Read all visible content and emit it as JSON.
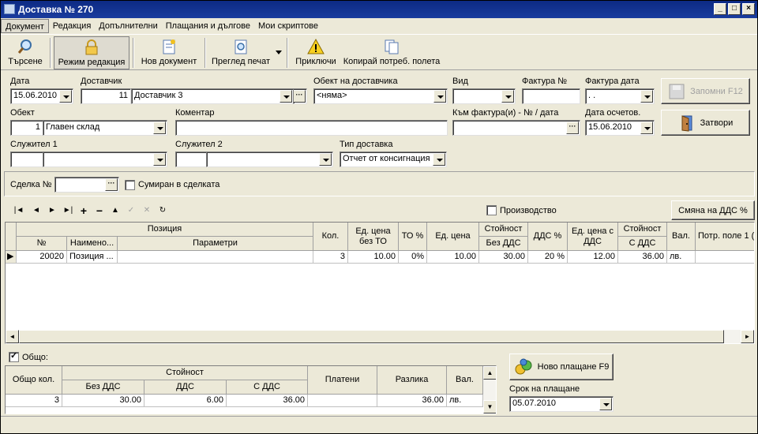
{
  "window": {
    "title": "Доставка № 270"
  },
  "menu": [
    "Документ",
    "Редакция",
    "Допълнителни",
    "Плащания и дългове",
    "Мои скриптове"
  ],
  "toolbar": {
    "search": "Търсене",
    "edit_mode": "Режим редакция",
    "new_doc": "Нов документ",
    "print_preview": "Преглед печат",
    "finish": "Приключи",
    "copy_fields": "Копирай потреб. полета"
  },
  "header": {
    "date_label": "Дата",
    "date_value": "15.06.2010",
    "supplier_label": "Доставчик",
    "supplier_id": "11",
    "supplier_name": "Доставчик 3",
    "supplier_object_label": "Обект на доставчика",
    "supplier_object_value": "<няма>",
    "type_label": "Вид",
    "type_value": "",
    "invoice_label": "Фактура №",
    "invoice_value": "",
    "invoice_date_label": "Фактура дата",
    "invoice_date_value": ". .",
    "object_label": "Обект",
    "object_id": "1",
    "object_name": "Главен склад",
    "comment_label": "Коментар",
    "comment_value": "",
    "to_invoice_label": "Към фактура(и) - № / дата",
    "to_invoice_value": "",
    "accounting_date_label": "Дата осчетов.",
    "accounting_date_value": "15.06.2010",
    "employee1_label": "Служител 1",
    "employee2_label": "Служител 2",
    "delivery_type_label": "Тип доставка",
    "delivery_type_value": "Отчет от консигнация"
  },
  "buttons": {
    "save": "Запомни  F12",
    "close": "Затвори",
    "vat_change": "Смяна на ДДС %",
    "new_payment": "Ново плащане  F9"
  },
  "deal": {
    "label": "Сделка №",
    "value": "",
    "summed_label": "Сумиран в сделката",
    "summed": false
  },
  "production": {
    "label": "Производство",
    "checked": false
  },
  "items_grid": {
    "group_header": "Позиция",
    "columns": [
      "№",
      "Наимено...",
      "Параметри",
      "Кол.",
      "Ед. цена без ТО",
      "ТО %",
      "Ед. цена",
      "Стойност",
      "Без ДДС",
      "ДДС %",
      "Ед. цена с ДДС",
      "Стойност",
      "С ДДС",
      "Вал.",
      "Потр. поле 1 ("
    ],
    "rows": [
      {
        "no": "20020",
        "name": "Позиция ...",
        "params": "",
        "qty": "3",
        "price_no_to": "10.00",
        "to_pct": "0%",
        "price": "10.00",
        "value_no_vat": "30.00",
        "vat_pct": "20 %",
        "price_vat": "12.00",
        "value_vat": "36.00",
        "currency": "лв.",
        "user1": ""
      }
    ]
  },
  "totals": {
    "checkbox_label": "Общо:",
    "checked": true,
    "columns": [
      "Общо кол.",
      "Стойност",
      "Без ДДС",
      "ДДС",
      "С ДДС",
      "Платени",
      "Разлика",
      "Вал."
    ],
    "row": {
      "qty": "3",
      "no_vat": "30.00",
      "vat": "6.00",
      "with_vat": "36.00",
      "paid": "",
      "diff": "36.00",
      "currency": "лв."
    }
  },
  "payment": {
    "due_label": "Срок на плащане",
    "due_value": "05.07.2010"
  }
}
